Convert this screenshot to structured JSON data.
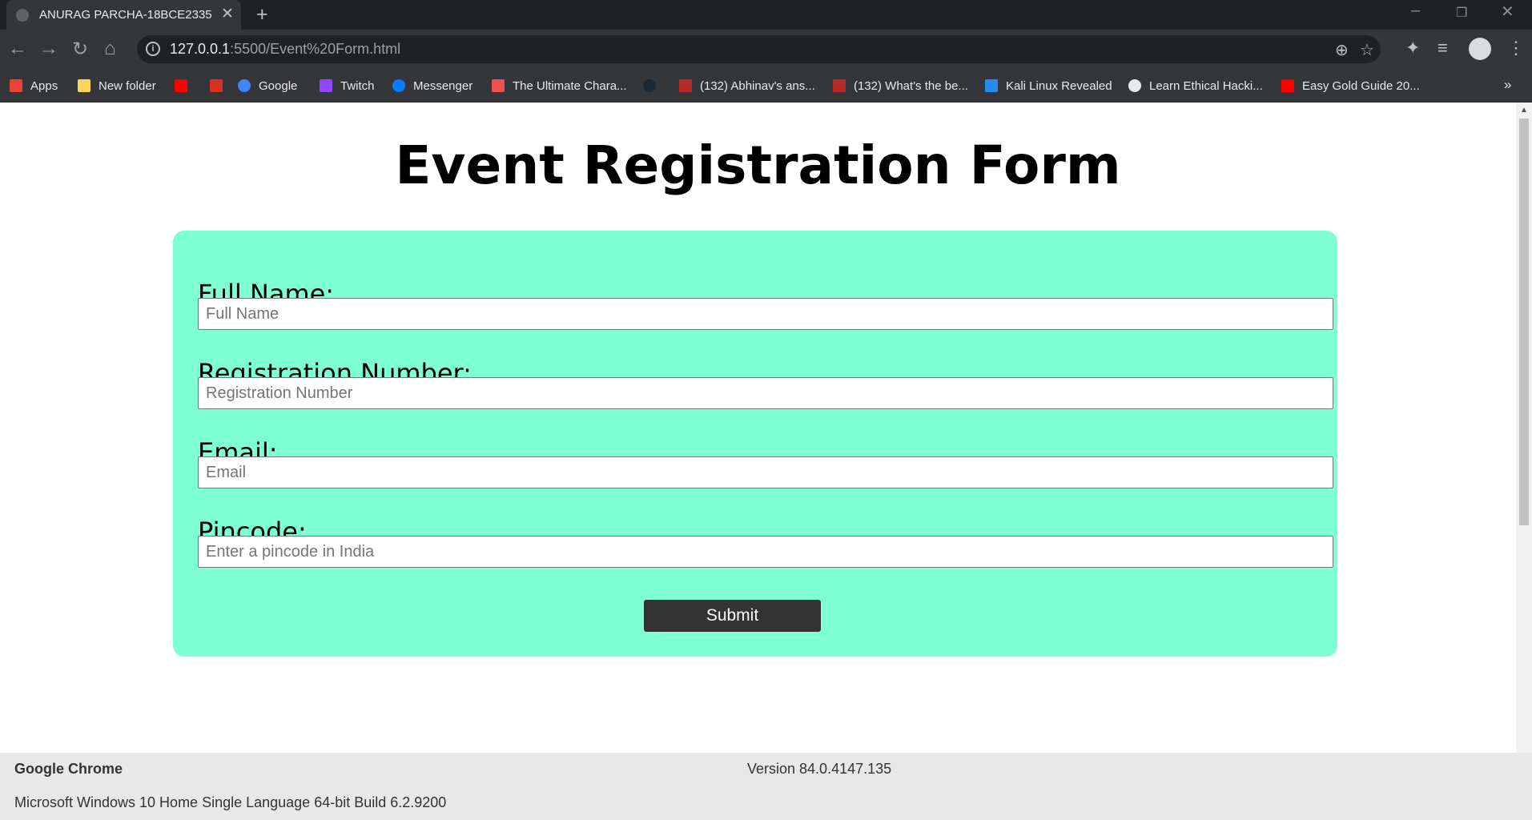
{
  "browser": {
    "tab_title": "ANURAG PARCHA-18BCE2335",
    "tab_close_glyph": "✕",
    "new_tab_glyph": "+",
    "url_host": "127.0.0.1",
    "url_rest": ":5500/Event%20Form.html",
    "bookmarks": [
      {
        "label": "Apps",
        "icon": "apps-grid-icon",
        "color": "#ea4335"
      },
      {
        "label": "New folder",
        "icon": "folder-icon",
        "color": "#f9d65b"
      },
      {
        "label": "",
        "icon": "youtube-icon",
        "color": "#ff0000"
      },
      {
        "label": "",
        "icon": "gmail-icon",
        "color": "#d93025"
      },
      {
        "label": "Google",
        "icon": "google-icon",
        "color": "#4285f4"
      },
      {
        "label": "Twitch",
        "icon": "twitch-icon",
        "color": "#9146ff"
      },
      {
        "label": "Messenger",
        "icon": "messenger-icon",
        "color": "#0a7cff"
      },
      {
        "label": "The Ultimate Chara...",
        "icon": "udemy-icon",
        "color": "#ec5252"
      },
      {
        "label": "",
        "icon": "steam-icon",
        "color": "#1b2838"
      },
      {
        "label": "(132) Abhinav's ans...",
        "icon": "quora-icon",
        "color": "#b92b27"
      },
      {
        "label": "(132) What's the be...",
        "icon": "quora-icon",
        "color": "#b92b27"
      },
      {
        "label": "Kali Linux Revealed",
        "icon": "kali-icon",
        "color": "#268bee"
      },
      {
        "label": "Learn Ethical Hacki...",
        "icon": "globe-icon",
        "color": "#e8eaed"
      },
      {
        "label": "Easy Gold Guide 20...",
        "icon": "youtube-icon",
        "color": "#ff0000"
      }
    ],
    "more_glyph": "»"
  },
  "page": {
    "title": "Event Registration Form",
    "accent_color": "#7fffd4",
    "fields": [
      {
        "label": "Full Name:",
        "placeholder": "Full Name"
      },
      {
        "label": "Registration Number:",
        "placeholder": "Registration Number"
      },
      {
        "label": "Email:",
        "placeholder": "Email"
      },
      {
        "label": "Pincode:",
        "placeholder": "Enter a pincode in India"
      }
    ],
    "submit_label": "Submit"
  },
  "footer": {
    "app_name": "Google Chrome",
    "version": "Version 84.0.4147.135",
    "os": "Microsoft Windows 10 Home Single Language 64-bit Build 6.2.9200"
  }
}
